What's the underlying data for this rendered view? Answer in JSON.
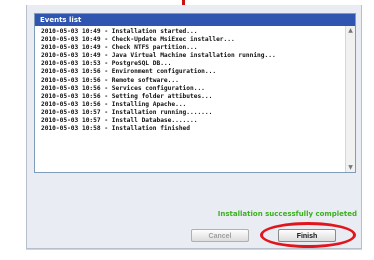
{
  "events_panel": {
    "title": "Events list",
    "entries": [
      "2010-05-03 10:49 - Installation started...",
      "2010-05-03 10:49 - Check-Update MsiExec installer...",
      "2010-05-03 10:49 - Check NTFS partition...",
      "2010-05-03 10:49 - Java Virtual Machine installation running...",
      "2010-05-03 10:53 - PostgreSQL DB...",
      "2010-05-03 10:56 - Environment configuration...",
      "2010-05-03 10:56 - Remote software...",
      "2010-05-03 10:56 - Services configuration...",
      "2010-05-03 10:56 - Setting folder attibutes...",
      "2010-05-03 10:56 - Installing Apache...",
      "2010-05-03 10:57 - Installation running.......",
      "2010-05-03 10:57 - Install Database.......",
      "2010-05-03 10:58 - Installation finished"
    ]
  },
  "status_text": "Installation successfully completed",
  "buttons": {
    "cancel": "Cancel",
    "finish": "Finish"
  },
  "colors": {
    "header_blue": "#2f55b1",
    "success_green": "#39b21d",
    "highlight_red": "#e0161d"
  }
}
